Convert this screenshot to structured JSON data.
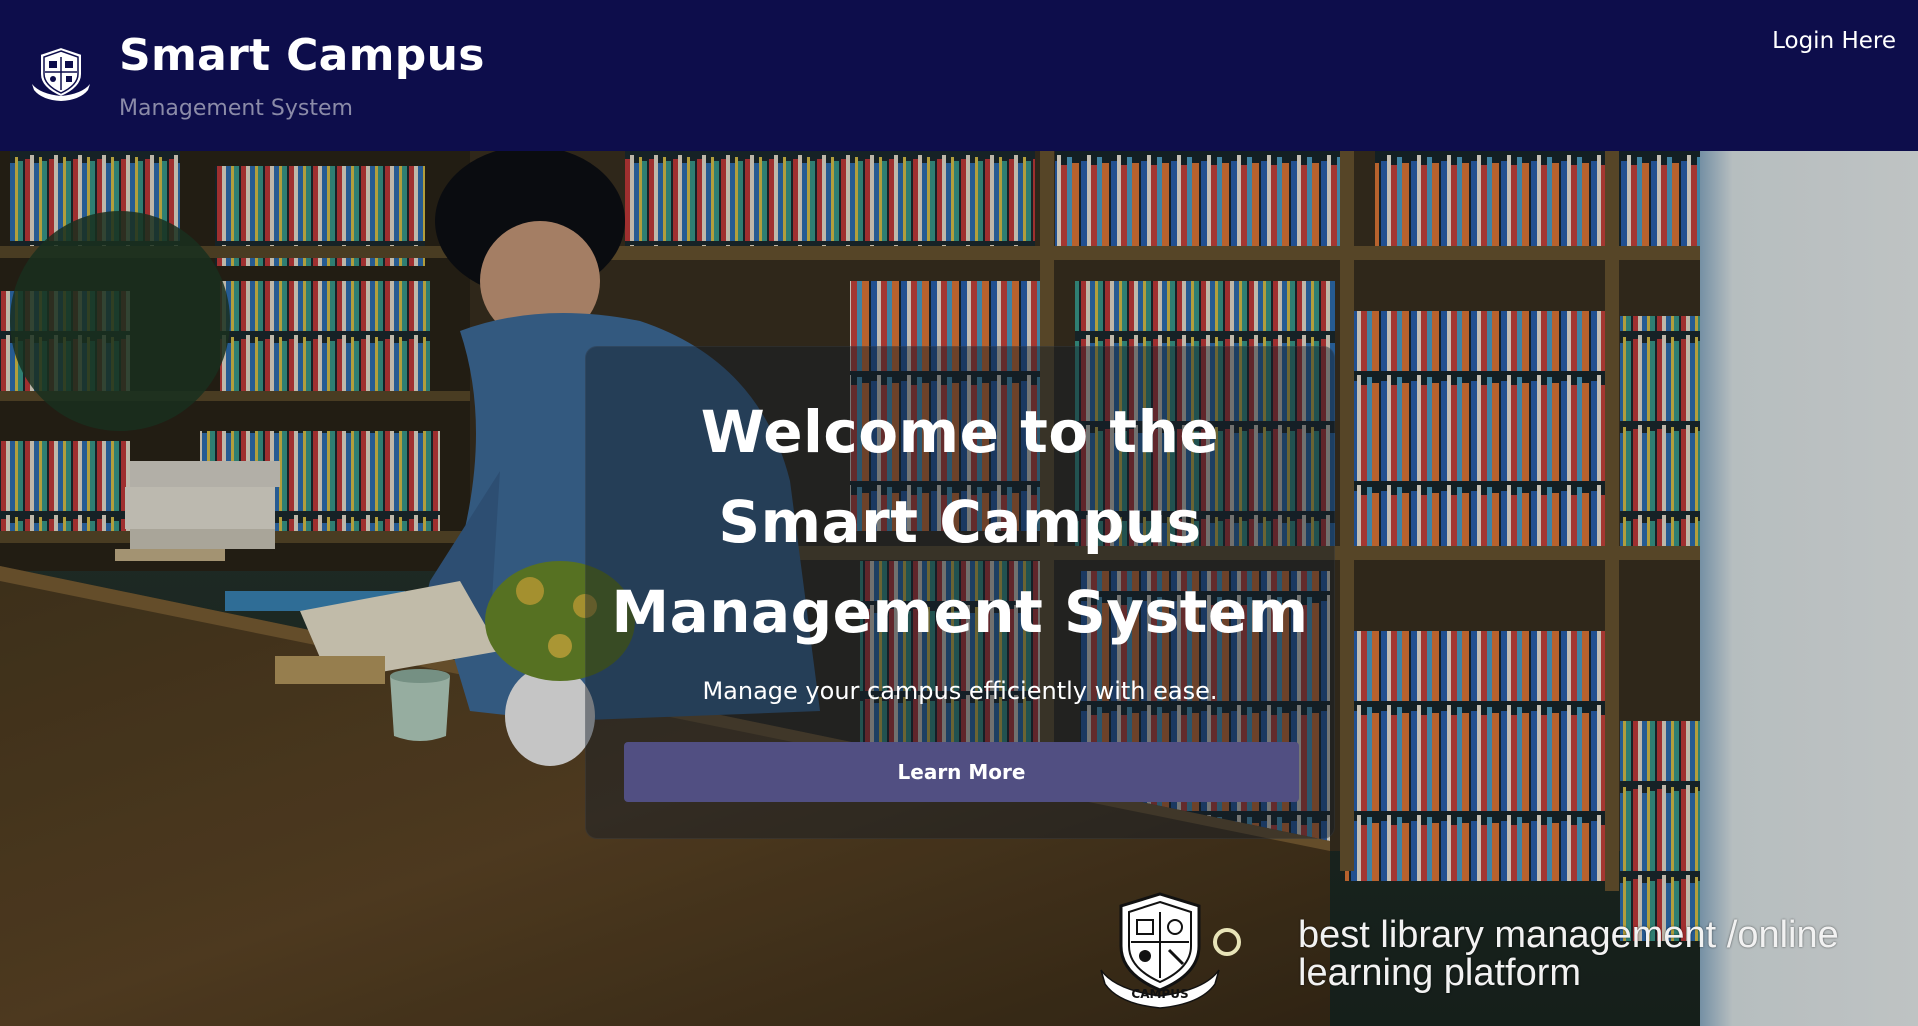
{
  "header": {
    "brand_title": "Smart Campus",
    "brand_subtitle": "Management System",
    "login_label": "Login Here",
    "logo_icon": "campus-crest-icon"
  },
  "hero": {
    "title_lines": [
      "Welcome to the",
      "Smart Campus",
      "Management System"
    ],
    "subtitle": "Manage your campus efficiently with ease.",
    "button_label": "Learn More",
    "background": "library-photo"
  },
  "watermark": {
    "line1": "best library management /online",
    "line2": "learning platform",
    "logo_icon": "campus-crest-icon",
    "logo_text": "CAMPUS"
  },
  "colors": {
    "header_bg": "#0d0d4b",
    "button_bg": "#514f82",
    "subtitle_text": "#8b8ba8"
  }
}
